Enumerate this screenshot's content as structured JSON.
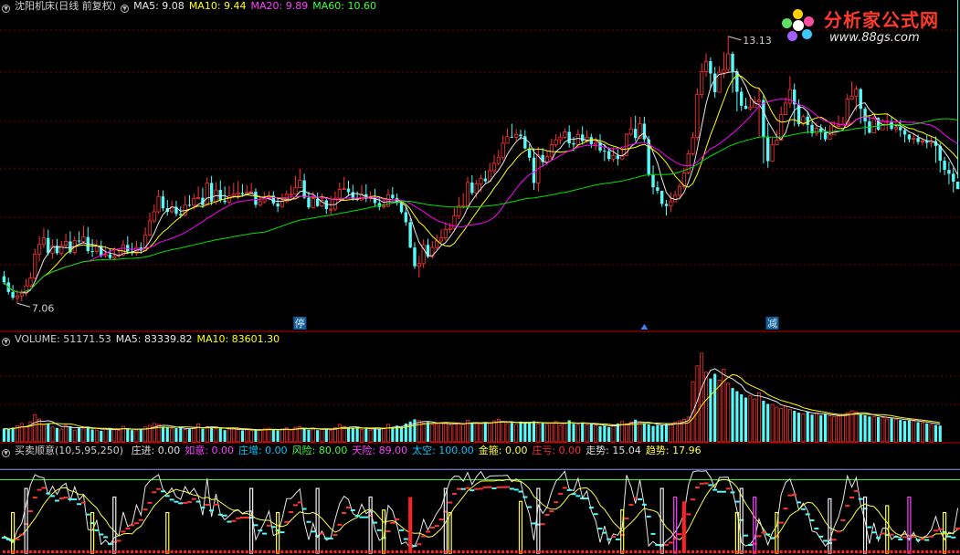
{
  "main_header": {
    "title": "沈阳机床(日线 前复权)",
    "ma5": "MA5: 9.08",
    "ma10": "MA10: 9.44",
    "ma20": "MA20: 9.89",
    "ma60": "MA60: 10.60"
  },
  "volume_header": {
    "title": "VOLUME: 51171.53",
    "ma5": "MA5: 83339.82",
    "ma10": "MA10: 83601.30"
  },
  "indicator_header": {
    "title": "买卖顺意(10,5,95,250)",
    "items": [
      {
        "label": "庄进: 0.00",
        "color": "#e0e0e0"
      },
      {
        "label": "如意: 0.00",
        "color": "#ff40ff"
      },
      {
        "label": "庄增: 0.00",
        "color": "#00c8ff"
      },
      {
        "label": "风险: 80.00",
        "color": "#40ff40"
      },
      {
        "label": "天险: 89.00",
        "color": "#ff40ff"
      },
      {
        "label": "太空: 100.00",
        "color": "#00c8ff"
      },
      {
        "label": "金箍: 0.00",
        "color": "#ffff40"
      },
      {
        "label": "庄亏: 0.00",
        "color": "#ff3030"
      },
      {
        "label": "走势: 15.04",
        "color": "#e0e0e0"
      },
      {
        "label": "趋势: 17.96",
        "color": "#ffff40"
      }
    ]
  },
  "logo": {
    "name": "分析家公式网",
    "url": "www.88gs.com"
  },
  "colors": {
    "up": "#ff3232",
    "down": "#54fcfc",
    "ma5": "#e8e8e8",
    "ma10": "#ffff00",
    "ma20": "#ff00ff",
    "ma60": "#00e000",
    "grid": "#7a0000",
    "separator": "#c00000"
  },
  "chart_data": {
    "type": "candlestick",
    "price_axis": {
      "ylim": [
        6.4,
        13.6
      ]
    },
    "annotations": {
      "high_label": "13.13",
      "low_label": "7.06",
      "markers": [
        "停",
        "减"
      ]
    },
    "open": [
      7.6,
      7.46,
      7.24,
      7.11,
      7.15,
      7.21,
      7.38,
      7.56,
      8.11,
      8.33,
      8.48,
      8.13,
      8.3,
      8.13,
      8.31,
      8.4,
      8.15,
      8.42,
      8.4,
      8.5,
      8.18,
      8.17,
      8.29,
      8.07,
      8.1,
      8.02,
      8.07,
      8.09,
      8.32,
      8.17,
      8.13,
      8.26,
      8.19,
      8.54,
      8.87,
      9.08,
      9.43,
      9.16,
      9.08,
      9.19,
      9.03,
      9.0,
      9.24,
      9.23,
      9.38,
      9.4,
      9.23,
      9.74,
      9.31,
      9.58,
      9.34,
      9.3,
      9.44,
      9.48,
      9.51,
      9.48,
      9.53,
      9.54,
      9.24,
      9.31,
      9.37,
      9.45,
      9.27,
      9.2,
      9.32,
      9.48,
      9.48,
      9.63,
      9.8,
      9.4,
      9.18,
      9.38,
      9.21,
      9.34,
      9.14,
      9.14,
      9.39,
      9.59,
      9.61,
      9.53,
      9.38,
      9.35,
      9.48,
      9.38,
      9.41,
      9.28,
      9.19,
      9.21,
      9.47,
      9.39,
      9.28,
      9.07,
      8.84,
      8.26,
      7.83,
      7.89,
      8.32,
      8.05,
      8.26,
      8.41,
      8.48,
      8.67,
      8.7,
      8.99,
      9.21,
      9.21,
      9.75,
      9.51,
      9.72,
      9.84,
      9.78,
      10.02,
      10.19,
      10.33,
      10.65,
      10.8,
      10.79,
      10.85,
      10.81,
      10.53,
      10.32,
      9.74,
      10.38,
      10.22,
      10.34,
      10.62,
      10.73,
      10.79,
      10.91,
      10.65,
      10.62,
      10.85,
      10.7,
      10.79,
      10.63,
      10.67,
      10.48,
      10.47,
      10.29,
      10.37,
      10.29,
      10.37,
      10.86,
      10.98,
      10.77,
      11.1,
      10.74,
      9.94,
      9.64,
      9.56,
      9.26,
      9.21,
      9.31,
      9.46,
      9.66,
      9.97,
      10.41,
      10.78,
      11.77,
      12.29,
      12.53,
      12.25,
      11.82,
      12.28,
      12.34,
      12.7,
      12.3,
      11.83,
      11.51,
      11.44,
      11.48,
      11.6,
      11.64,
      10.8,
      10.24,
      10.62,
      10.72,
      11.31,
      11.57,
      11.88,
      11.54,
      11.09,
      11.26,
      11.07,
      10.88,
      10.99,
      10.9,
      10.74,
      10.84,
      11.04,
      11.07,
      11.09,
      11.66,
      11.73,
      11.89,
      11.44,
      11.15,
      10.89,
      11.23,
      10.96,
      11.15,
      11.15,
      10.98,
      11.02,
      10.95,
      10.85,
      10.74,
      10.77,
      10.68,
      10.7,
      10.66,
      10.7,
      10.59,
      10.25,
      10.04,
      9.95,
      9.77
    ],
    "high": [
      7.72,
      7.57,
      7.4,
      7.28,
      7.3,
      7.54,
      7.69,
      8.23,
      8.52,
      8.71,
      8.67,
      8.45,
      8.46,
      8.41,
      8.58,
      8.63,
      8.52,
      8.63,
      8.76,
      8.73,
      8.45,
      8.44,
      8.42,
      8.3,
      8.24,
      8.27,
      8.24,
      8.43,
      8.52,
      8.37,
      8.42,
      8.38,
      8.72,
      9.06,
      9.25,
      9.58,
      9.57,
      9.35,
      9.34,
      9.33,
      9.2,
      9.44,
      9.46,
      9.49,
      9.66,
      9.63,
      9.87,
      9.9,
      9.76,
      9.8,
      9.66,
      9.67,
      9.74,
      9.78,
      9.71,
      9.69,
      9.74,
      9.62,
      9.45,
      9.53,
      9.55,
      9.55,
      9.41,
      9.5,
      9.57,
      9.68,
      9.9,
      10.07,
      9.95,
      9.54,
      9.54,
      9.52,
      9.5,
      9.41,
      9.44,
      9.54,
      9.75,
      9.88,
      9.79,
      9.7,
      9.55,
      9.69,
      9.71,
      9.55,
      9.6,
      9.42,
      9.4,
      9.6,
      9.65,
      9.5,
      9.35,
      9.21,
      8.93,
      8.38,
      8.07,
      8.45,
      8.46,
      8.41,
      8.56,
      8.68,
      8.84,
      8.82,
      9.17,
      9.42,
      9.51,
      9.88,
      9.92,
      9.81,
      9.93,
      10.02,
      10.2,
      10.38,
      10.5,
      10.83,
      10.99,
      11.1,
      10.98,
      10.96,
      10.95,
      10.63,
      10.54,
      10.57,
      10.54,
      10.48,
      10.76,
      10.86,
      10.89,
      10.99,
      11.06,
      10.8,
      10.97,
      11.04,
      10.94,
      10.87,
      10.78,
      10.86,
      10.64,
      10.56,
      10.56,
      10.51,
      10.56,
      10.88,
      11.25,
      11.28,
      11.26,
      11.26,
      10.82,
      10.14,
      9.78,
      9.56,
      9.35,
      9.52,
      9.56,
      9.74,
      10.09,
      10.5,
      10.9,
      11.91,
      12.48,
      12.71,
      12.62,
      12.4,
      12.42,
      12.74,
      13.1,
      12.75,
      12.36,
      11.93,
      11.69,
      11.76,
      11.73,
      11.92,
      11.77,
      11.11,
      10.78,
      10.95,
      11.49,
      11.7,
      12.19,
      12.02,
      11.66,
      11.31,
      11.37,
      11.15,
      11.13,
      11.09,
      11.03,
      11.06,
      11.16,
      11.29,
      11.26,
      11.78,
      12.07,
      11.97,
      11.92,
      11.49,
      11.27,
      11.28,
      11.25,
      11.21,
      11.33,
      11.26,
      11.14,
      11.19,
      11.01,
      10.86,
      10.89,
      10.85,
      10.77,
      10.84,
      10.79,
      10.81,
      10.66,
      10.34,
      10.23,
      10.09,
      9.84
    ],
    "low": [
      7.41,
      7.18,
      7.06,
      6.98,
      7.03,
      7.15,
      7.34,
      7.52,
      7.94,
      8.25,
      8.08,
      8.0,
      8.09,
      8.07,
      8.26,
      8.11,
      8.09,
      8.36,
      8.35,
      8.12,
      8.04,
      8.11,
      8.03,
      8.02,
      7.98,
      7.96,
      8.02,
      8.05,
      8.11,
      8.07,
      8.07,
      8.12,
      8.17,
      8.52,
      8.82,
      9.03,
      9.09,
      8.99,
      9.04,
      8.97,
      8.93,
      8.97,
      9.19,
      9.13,
      9.36,
      9.16,
      9.22,
      9.23,
      9.24,
      9.29,
      9.25,
      9.25,
      9.39,
      9.36,
      9.42,
      9.45,
      9.48,
      9.17,
      9.2,
      9.27,
      9.34,
      9.22,
      9.07,
      9.17,
      9.28,
      9.39,
      9.47,
      9.62,
      9.37,
      9.14,
      9.15,
      9.19,
      9.18,
      9.03,
      9.0,
      9.09,
      9.34,
      9.58,
      9.46,
      9.33,
      9.32,
      9.33,
      9.3,
      9.31,
      9.21,
      9.11,
      9.15,
      9.18,
      9.34,
      9.22,
      9.03,
      8.76,
      8.24,
      7.77,
      7.57,
      7.79,
      8.01,
      8.01,
      8.21,
      8.37,
      8.42,
      8.59,
      8.63,
      8.91,
      9.15,
      9.13,
      9.46,
      9.39,
      9.53,
      9.74,
      9.76,
      9.94,
      10.15,
      10.26,
      10.64,
      10.77,
      10.71,
      10.73,
      10.51,
      10.24,
      9.58,
      9.55,
      10.11,
      10.14,
      10.26,
      10.56,
      10.63,
      10.75,
      10.55,
      10.47,
      10.56,
      10.62,
      10.66,
      10.54,
      10.49,
      10.43,
      10.24,
      10.24,
      10.22,
      10.14,
      10.26,
      10.37,
      10.82,
      10.7,
      10.75,
      10.68,
      9.89,
      9.48,
      9.49,
      9.19,
      8.99,
      9.08,
      9.31,
      9.39,
      9.6,
      9.94,
      10.37,
      10.71,
      11.68,
      12.17,
      11.91,
      11.69,
      11.81,
      12.14,
      12.27,
      11.81,
      11.38,
      11.39,
      11.43,
      11.39,
      11.51,
      10.8,
      10.19,
      10.09,
      10.52,
      10.69,
      11.22,
      11.55,
      11.46,
      11.04,
      11.03,
      11.05,
      10.87,
      10.8,
      10.82,
      10.73,
      10.69,
      10.81,
      10.93,
      11.01,
      11.07,
      11.62,
      11.67,
      11.39,
      11.1,
      10.84,
      10.87,
      10.93,
      10.94,
      10.97,
      10.93,
      10.94,
      10.9,
      10.8,
      10.67,
      10.67,
      10.63,
      10.62,
      10.6,
      10.53,
      10.56,
      10.2,
      9.98,
      9.92,
      9.71,
      9.52
    ],
    "close": [
      7.46,
      7.24,
      7.11,
      7.15,
      7.21,
      7.38,
      7.56,
      8.11,
      8.33,
      8.48,
      8.13,
      8.3,
      8.13,
      8.31,
      8.4,
      8.15,
      8.42,
      8.4,
      8.5,
      8.18,
      8.17,
      8.29,
      8.07,
      8.1,
      8.02,
      8.07,
      8.09,
      8.32,
      8.17,
      8.13,
      8.26,
      8.19,
      8.54,
      8.87,
      9.08,
      9.43,
      9.16,
      9.08,
      9.19,
      9.03,
      9.0,
      9.24,
      9.23,
      9.38,
      9.4,
      9.23,
      9.74,
      9.31,
      9.58,
      9.34,
      9.3,
      9.44,
      9.48,
      9.51,
      9.48,
      9.53,
      9.54,
      9.24,
      9.31,
      9.37,
      9.45,
      9.27,
      9.2,
      9.32,
      9.48,
      9.48,
      9.63,
      9.8,
      9.4,
      9.18,
      9.38,
      9.21,
      9.34,
      9.14,
      9.14,
      9.39,
      9.59,
      9.61,
      9.53,
      9.38,
      9.35,
      9.48,
      9.38,
      9.41,
      9.28,
      9.19,
      9.21,
      9.47,
      9.39,
      9.28,
      9.07,
      8.84,
      8.26,
      7.83,
      7.89,
      8.32,
      8.05,
      8.26,
      8.41,
      8.48,
      8.67,
      8.7,
      8.99,
      9.21,
      9.21,
      9.75,
      9.51,
      9.72,
      9.84,
      9.78,
      10.02,
      10.19,
      10.33,
      10.65,
      10.8,
      10.79,
      10.85,
      10.81,
      10.53,
      10.32,
      9.74,
      10.38,
      10.22,
      10.34,
      10.62,
      10.73,
      10.79,
      10.91,
      10.65,
      10.62,
      10.85,
      10.7,
      10.79,
      10.63,
      10.67,
      10.48,
      10.47,
      10.29,
      10.37,
      10.29,
      10.37,
      10.86,
      10.98,
      10.77,
      11.1,
      10.74,
      9.94,
      9.64,
      9.56,
      9.26,
      9.21,
      9.31,
      9.46,
      9.66,
      9.97,
      10.41,
      10.78,
      11.77,
      12.29,
      12.53,
      12.25,
      11.82,
      12.28,
      12.34,
      12.7,
      12.3,
      11.83,
      11.51,
      11.44,
      11.48,
      11.6,
      11.64,
      10.8,
      10.24,
      10.62,
      10.72,
      11.31,
      11.57,
      11.88,
      11.54,
      11.09,
      11.26,
      11.07,
      10.88,
      10.99,
      10.9,
      10.74,
      10.84,
      11.04,
      11.07,
      11.09,
      11.66,
      11.73,
      11.89,
      11.44,
      11.15,
      10.89,
      11.23,
      10.96,
      11.15,
      11.15,
      10.98,
      11.02,
      10.95,
      10.85,
      10.74,
      10.77,
      10.68,
      10.7,
      10.66,
      10.7,
      10.59,
      10.25,
      10.04,
      9.95,
      9.77,
      9.6
    ],
    "volume": [
      42000,
      39000,
      45000,
      51000,
      58000,
      48000,
      63000,
      86000,
      72000,
      54000,
      58000,
      47000,
      44000,
      40000,
      52000,
      49000,
      37000,
      45000,
      43000,
      48000,
      39000,
      37000,
      35000,
      41000,
      44000,
      38000,
      36000,
      49000,
      42000,
      37000,
      35000,
      39000,
      47000,
      52000,
      58000,
      55000,
      48000,
      45000,
      41000,
      43000,
      46000,
      39000,
      40000,
      44000,
      57000,
      42000,
      48000,
      45000,
      41000,
      44000,
      37000,
      40000,
      42000,
      38000,
      36000,
      39000,
      35000,
      38000,
      37000,
      41000,
      43000,
      38000,
      36000,
      39000,
      44000,
      37000,
      46000,
      48000,
      41000,
      38000,
      43000,
      37000,
      39000,
      41000,
      36000,
      45000,
      55000,
      49000,
      44000,
      43000,
      46000,
      39000,
      41000,
      37000,
      43000,
      42000,
      44000,
      55000,
      46000,
      51000,
      47000,
      58000,
      64000,
      71000,
      67000,
      59000,
      62000,
      55000,
      56000,
      61000,
      58000,
      52000,
      57000,
      60000,
      55000,
      68000,
      61000,
      59000,
      57000,
      62000,
      60000,
      66000,
      71000,
      63000,
      58000,
      60000,
      55000,
      64000,
      58000,
      62000,
      65000,
      57000,
      61000,
      55000,
      59000,
      64000,
      52000,
      60000,
      68000,
      57000,
      55000,
      61000,
      54000,
      56000,
      53000,
      49000,
      51000,
      46000,
      52000,
      58000,
      64000,
      57000,
      63000,
      70000,
      62000,
      58000,
      55000,
      50000,
      53000,
      52000,
      56000,
      58000,
      62000,
      66000,
      71000,
      78000,
      190000,
      240000,
      280000,
      220000,
      200000,
      215000,
      195000,
      230000,
      185000,
      170000,
      160000,
      150000,
      140000,
      145000,
      135000,
      155000,
      130000,
      120000,
      118000,
      110000,
      105000,
      112000,
      103000,
      98000,
      92000,
      88000,
      95000,
      86000,
      91000,
      84000,
      88000,
      82000,
      79000,
      81000,
      86000,
      92000,
      98000,
      95000,
      88000,
      84000,
      80000,
      79000,
      78000,
      76000,
      72000,
      74000,
      71000,
      69000,
      66000,
      68000,
      65000,
      62000,
      60000,
      58000,
      55000,
      53000,
      51171.53
    ],
    "volume_axis": {
      "ylim": [
        0,
        300000
      ]
    },
    "indicator": {
      "ylim": [
        -5,
        105
      ],
      "reference_lines": [
        {
          "value": 92,
          "color": "#9090ff"
        },
        {
          "value": 80,
          "color": "#40ff40"
        }
      ],
      "yellow_bars": [
        [
          2,
          42
        ],
        [
          20,
          42
        ],
        [
          37,
          42
        ],
        [
          62,
          42
        ],
        [
          86,
          45
        ],
        [
          101,
          42
        ],
        [
          117,
          55
        ],
        [
          140,
          45
        ],
        [
          166,
          42
        ],
        [
          175,
          42
        ],
        [
          200,
          50
        ],
        [
          213,
          42
        ]
      ],
      "white_bars": [
        [
          5,
          70
        ],
        [
          25,
          60
        ],
        [
          56,
          70
        ],
        [
          71,
          70
        ],
        [
          83,
          60
        ],
        [
          100,
          70
        ],
        [
          121,
          70
        ],
        [
          149,
          70
        ],
        [
          167,
          70
        ],
        [
          187,
          58
        ],
        [
          195,
          60
        ]
      ],
      "magenta_bars": [
        [
          152,
          60
        ],
        [
          170,
          60
        ],
        [
          205,
          60
        ]
      ],
      "red_bars": [
        [
          92,
          60
        ],
        [
          154,
          55
        ]
      ]
    }
  }
}
